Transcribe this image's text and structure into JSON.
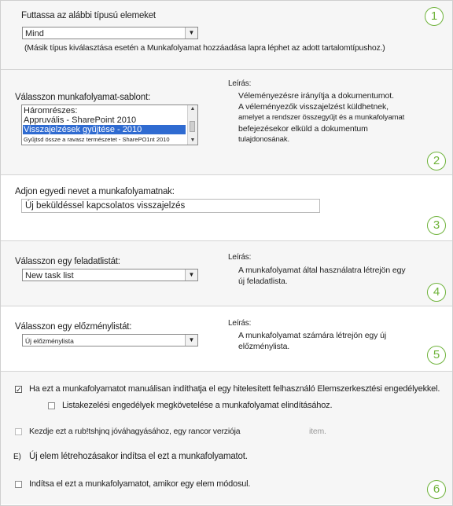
{
  "step_numbers": [
    "1",
    "2",
    "3",
    "4",
    "5",
    "6"
  ],
  "section1": {
    "label": "Futtassa az alábbi típusú elemeket",
    "select_value": "Mind",
    "note": "(Másik típus kiválasztása esetén a Munkafolyamat hozzáadása lapra léphet az adott tartalomtípushoz.)"
  },
  "section2": {
    "label": "Válasszon munkafolyamat-sablont:",
    "options": [
      "Háromrészes:",
      "Appruvális - SharePoint 2010",
      "Visszajelzések gyűjtése - 2010",
      "Gyűjtsd össze a ravasz természetet - SharePO1nt 2010"
    ],
    "selected_index": 2,
    "desc_title": "Leírás:",
    "desc_lines": [
      "Véleményezésre irányítja a dokumentumot.",
      "A véleményezők visszajelzést küldhetnek,",
      "amelyet a rendszer összegyűjt és a munkafolyamat",
      "befejezésekor elküld a dokumentum",
      "tulajdonosának."
    ]
  },
  "section3": {
    "label": "Adjon egyedi nevet a munkafolyamatnak:",
    "value": "Új beküldéssel kapcsolatos visszajelzés"
  },
  "section4": {
    "label": "Válasszon egy feladatlistát:",
    "select_value": "New task list",
    "desc_title": "Leírás:",
    "desc_lines": [
      "A munkafolyamat által használatra létrejön egy",
      "új feladatlista."
    ]
  },
  "section5": {
    "label": "Válasszon egy előzménylistát:",
    "select_value": "Új előzménylista",
    "desc_title": "Leírás:",
    "desc_lines": [
      "A munkafolyamat számára létrejön egy új",
      "előzménylista."
    ]
  },
  "section6": {
    "opt_manual": "Ha ezt a munkafolyamatot manuálisan indíthatja el egy hitelesített felhasználó Elemszerkesztési engedélyekkel.",
    "opt_manage_perm": "Listakezelési engedélyek megkövetelése a munkafolyamat elindításához.",
    "opt_approval_a": "Kezdje ezt a rub!tshjnq jóváhagyásához, egy rancor verziója",
    "opt_approval_b": "item.",
    "opt_create_marker": "E)",
    "opt_create": "Új elem létrehozásakor indítsa el ezt a munkafolyamatot.",
    "opt_change": "Indítsa el ezt a munkafolyamatot, amikor egy elem módosul."
  }
}
